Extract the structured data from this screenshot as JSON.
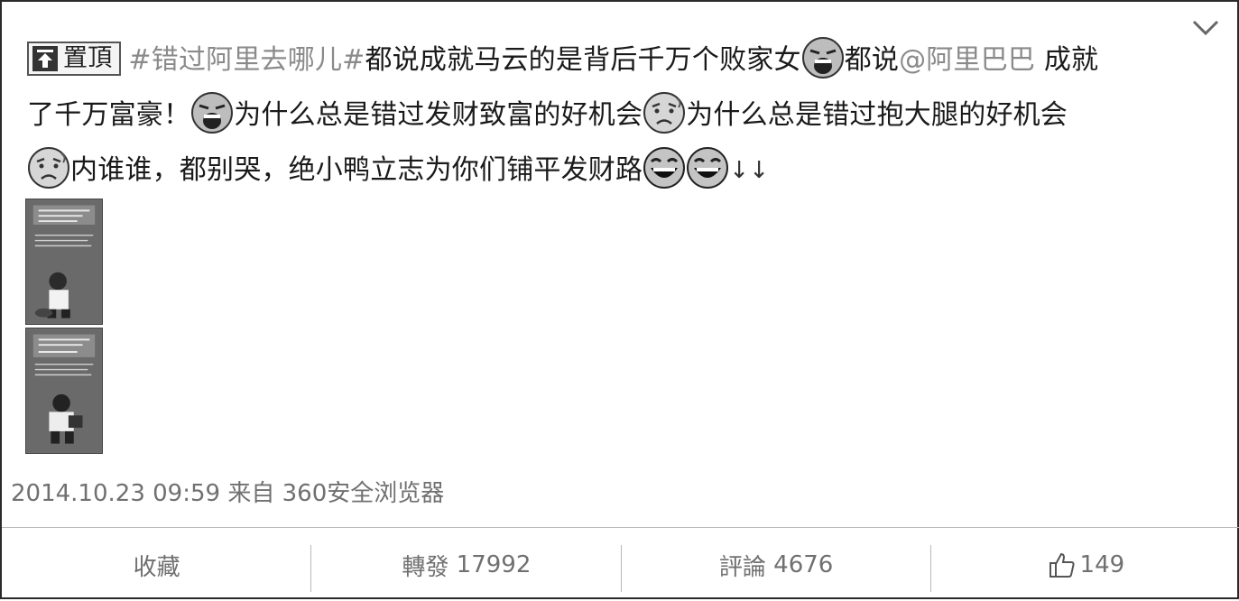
{
  "post": {
    "pin_label": "置頂",
    "hashtag": "#错过阿里去哪儿#",
    "segments": {
      "s1": "都说成就马云的是背后千万个败家女",
      "s2": "都说",
      "mention": "@阿里巴巴",
      "s3": " 成就",
      "s4": "了千万富豪！",
      "s5": "为什么总是错过发财致富的好机会",
      "s6": "为什么总是错过抱大腿的好机会",
      "s7": "内谁谁，都别哭，绝小鸭立志为你们铺平发财路",
      "arrows": "↓↓"
    },
    "emoji_names": [
      "crying-emoji",
      "crying-emoji",
      "shocked-emoji",
      "shocked-emoji",
      "laughing-emoji",
      "laughing-emoji"
    ]
  },
  "meta": {
    "date": "2014.10.23",
    "time": "09:59",
    "from_label": "来自",
    "source": "360安全浏览器"
  },
  "actions": {
    "favorite_label": "收藏",
    "repost_label": "轉發",
    "repost_count": "17992",
    "comment_label": "評論",
    "comment_count": "4676",
    "like_count": "149"
  }
}
